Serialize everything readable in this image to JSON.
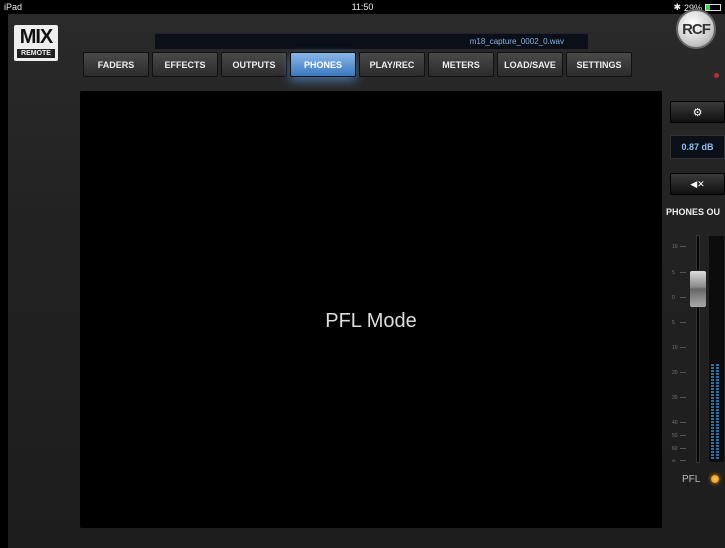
{
  "status": {
    "device": "iPad",
    "time": "11:50",
    "battery": "29%",
    "battery_level": 0.29
  },
  "logo": {
    "main": "MIX",
    "sub": "REMOTE"
  },
  "brand": "RCF",
  "file": {
    "name": "m18_capture_0002_0.wav"
  },
  "tabs": [
    {
      "label": "FADERS",
      "active": false
    },
    {
      "label": "EFFECTS",
      "active": false
    },
    {
      "label": "OUTPUTS",
      "active": false
    },
    {
      "label": "PHONES",
      "active": true
    },
    {
      "label": "PLAY/REC",
      "active": false
    },
    {
      "label": "METERS",
      "active": false
    },
    {
      "label": "LOAD/SAVE",
      "active": false
    },
    {
      "label": "SETTINGS",
      "active": false
    }
  ],
  "main": {
    "mode_text": "PFL Mode"
  },
  "side": {
    "gear_icon": "gear-icon",
    "level": "0.87 dB",
    "mute_icon": "speaker-mute-icon",
    "title": "PHONES OU",
    "scale": [
      "10",
      "5",
      "0",
      "5",
      "10",
      "20",
      "30",
      "40",
      "50",
      "60",
      "∞"
    ],
    "fader_level_db": 0.87,
    "meter_levels": [
      0.43,
      0.43
    ],
    "pfl_label": "PFL"
  },
  "colors": {
    "accent": "#4a8ad0",
    "meter": "#2d6fa8",
    "pfl_led": "#f39a1c"
  }
}
